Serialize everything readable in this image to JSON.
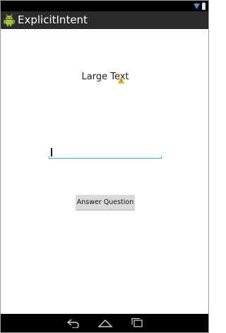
{
  "action_bar": {
    "title": "ExplicitIntent",
    "app_icon": "android-icon"
  },
  "status_bar": {
    "icons": [
      "wifi-icon",
      "battery-icon"
    ]
  },
  "content": {
    "large_text": "Large Text",
    "answer_input": {
      "value": "",
      "placeholder": ""
    },
    "answer_button_label": "Answer Question"
  },
  "nav_bar": {
    "icons": [
      "back-icon",
      "home-icon",
      "recents-icon"
    ]
  },
  "colors": {
    "status_bar": "#000000",
    "action_bar": "#2b2b2b",
    "accent": "#33b5e5",
    "button": "#d9d9d9",
    "android_green": "#a4c639",
    "warning": "#f5c400"
  }
}
